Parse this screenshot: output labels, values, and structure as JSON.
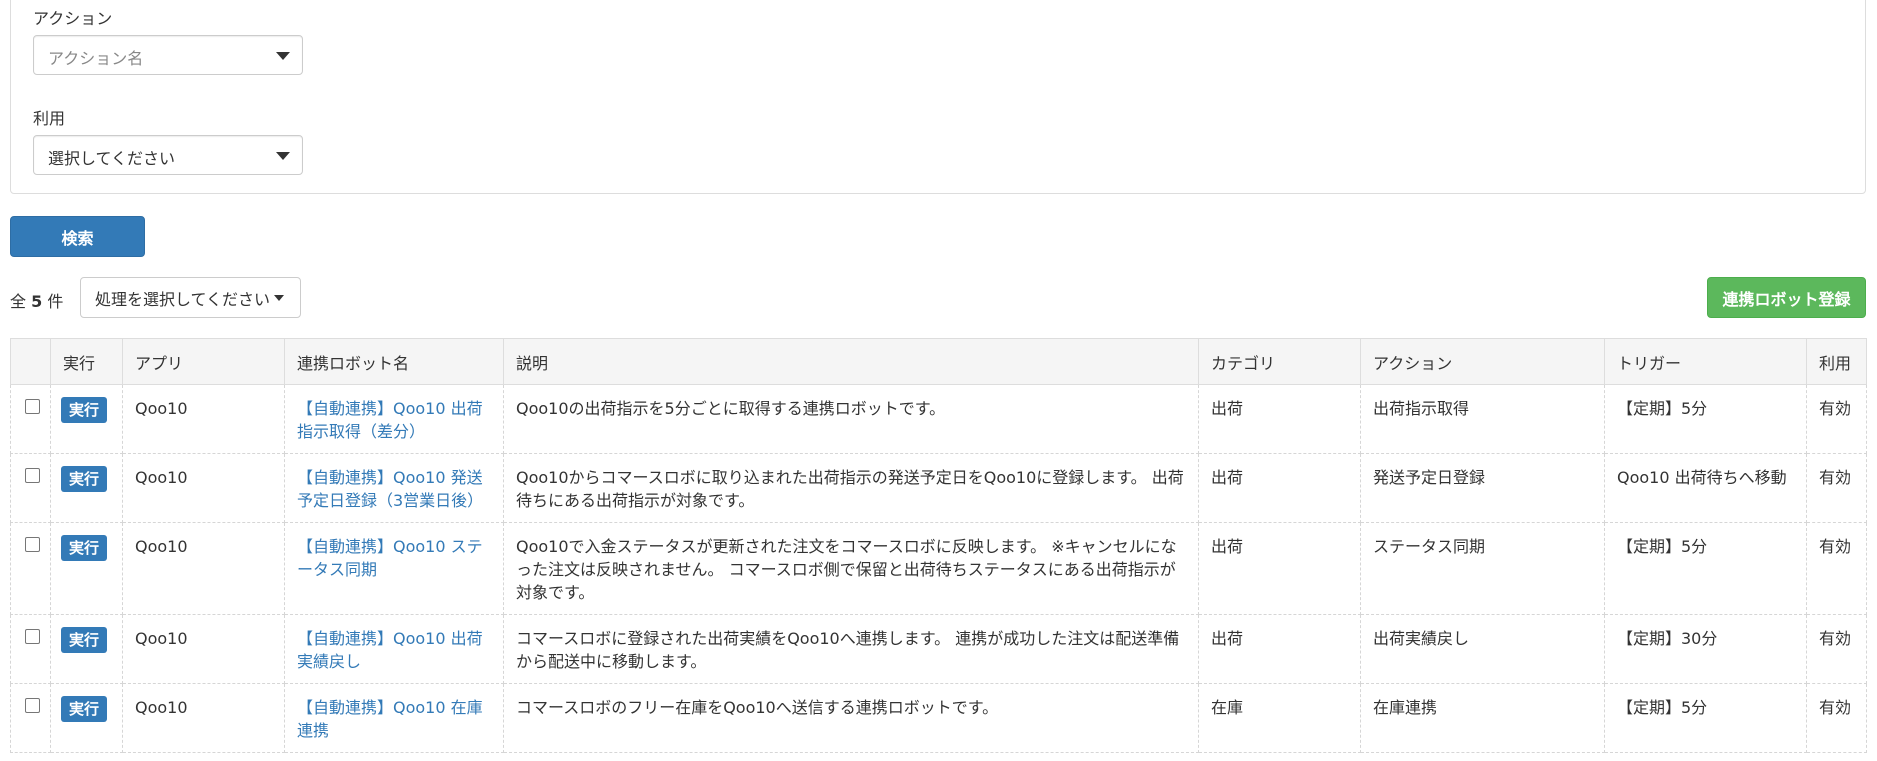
{
  "filters": {
    "action_label": "アクション",
    "action_placeholder": "アクション名",
    "usage_label": "利用",
    "usage_value": "選択してください"
  },
  "search_button": "検索",
  "result": {
    "count_prefix": "全",
    "count": "5",
    "count_suffix": "件",
    "bulk_action": "処理を選択してください",
    "register_button": "連携ロボット登録"
  },
  "table": {
    "headers": [
      "",
      "実行",
      "アプリ",
      "連携ロボット名",
      "説明",
      "カテゴリ",
      "アクション",
      "トリガー",
      "利用"
    ],
    "rows": [
      {
        "run": "実行",
        "app": "Qoo10",
        "name": "【自動連携】Qoo10 出荷指示取得（差分）",
        "description": "Qoo10の出荷指示を5分ごとに取得する連携ロボットです。",
        "category": "出荷",
        "action": "出荷指示取得",
        "trigger": "【定期】5分",
        "usage": "有効"
      },
      {
        "run": "実行",
        "app": "Qoo10",
        "name": "【自動連携】Qoo10 発送予定日登録（3営業日後）",
        "description": "Qoo10からコマースロボに取り込まれた出荷指示の発送予定日をQoo10に登録します。 出荷待ちにある出荷指示が対象です。",
        "category": "出荷",
        "action": "発送予定日登録",
        "trigger": "Qoo10 出荷待ちへ移動",
        "usage": "有効"
      },
      {
        "run": "実行",
        "app": "Qoo10",
        "name": "【自動連携】Qoo10 ステータス同期",
        "description": "Qoo10で入金ステータスが更新された注文をコマースロボに反映します。 ※キャンセルになった注文は反映されません。 コマースロボ側で保留と出荷待ちステータスにある出荷指示が対象です。",
        "category": "出荷",
        "action": "ステータス同期",
        "trigger": "【定期】5分",
        "usage": "有効"
      },
      {
        "run": "実行",
        "app": "Qoo10",
        "name": "【自動連携】Qoo10 出荷実績戻し",
        "description": "コマースロボに登録された出荷実績をQoo10へ連携します。 連携が成功した注文は配送準備から配送中に移動します。",
        "category": "出荷",
        "action": "出荷実績戻し",
        "trigger": "【定期】30分",
        "usage": "有効"
      },
      {
        "run": "実行",
        "app": "Qoo10",
        "name": "【自動連携】Qoo10 在庫連携",
        "description": "コマースロボのフリー在庫をQoo10へ送信する連携ロボットです。",
        "category": "在庫",
        "action": "在庫連携",
        "trigger": "【定期】5分",
        "usage": "有効"
      }
    ]
  }
}
